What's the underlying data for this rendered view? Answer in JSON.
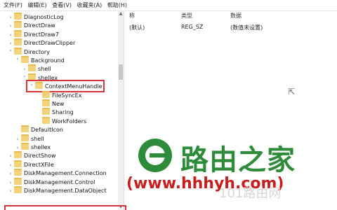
{
  "menu": [
    "文件(F)",
    "编辑(E)",
    "查看(V)",
    "收藏夹(A)",
    "帮助(H)"
  ],
  "tree": [
    {
      "label": "DiagnosticLog",
      "indent": 1,
      "chev": "›"
    },
    {
      "label": "DirectDraw",
      "indent": 1,
      "chev": "›"
    },
    {
      "label": "DirectDraw7",
      "indent": 1,
      "chev": "›"
    },
    {
      "label": "DirectDrawClipper",
      "indent": 1,
      "chev": "›"
    },
    {
      "label": "Directory",
      "indent": 1,
      "chev": "˅"
    },
    {
      "label": "Background",
      "indent": 2,
      "chev": "˅"
    },
    {
      "label": "shell",
      "indent": 3,
      "chev": "›"
    },
    {
      "label": "shellex",
      "indent": 3,
      "chev": "˅"
    },
    {
      "label": "ContextMenuHandle",
      "indent": 4,
      "chev": "˅",
      "highlight": true
    },
    {
      "label": "FileSyncEx",
      "indent": 5,
      "chev": ""
    },
    {
      "label": "New",
      "indent": 5,
      "chev": ""
    },
    {
      "label": "Sharing",
      "indent": 5,
      "chev": ""
    },
    {
      "label": "WorkFolders",
      "indent": 5,
      "chev": ""
    },
    {
      "label": "DefaultIcon",
      "indent": 2,
      "chev": ""
    },
    {
      "label": "shell",
      "indent": 2,
      "chev": "›"
    },
    {
      "label": "shellex",
      "indent": 2,
      "chev": "›"
    },
    {
      "label": "DirectShow",
      "indent": 1,
      "chev": "›"
    },
    {
      "label": "DirectXFile",
      "indent": 1,
      "chev": "›"
    },
    {
      "label": "DiskManagement.Connection",
      "indent": 1,
      "chev": "›"
    },
    {
      "label": "DiskManagement.Control",
      "indent": 1,
      "chev": "›"
    },
    {
      "label": "DiskManagement.DataObject",
      "indent": 1,
      "chev": "›"
    }
  ],
  "right": {
    "columns": [
      "称",
      "类型",
      "数据"
    ],
    "rows": [
      {
        "name": "(默认)",
        "type": "REG_SZ",
        "data": "(数值未设置)"
      }
    ]
  },
  "watermark": {
    "brand": "路由之家",
    "url": "(www.hhhyh.com)",
    "faint": "101路由网"
  },
  "colors": {
    "highlight": "#d9343a",
    "folder": "#f3d37a",
    "brand_green": "#2e8b39",
    "url_red": "#c81d1d"
  }
}
